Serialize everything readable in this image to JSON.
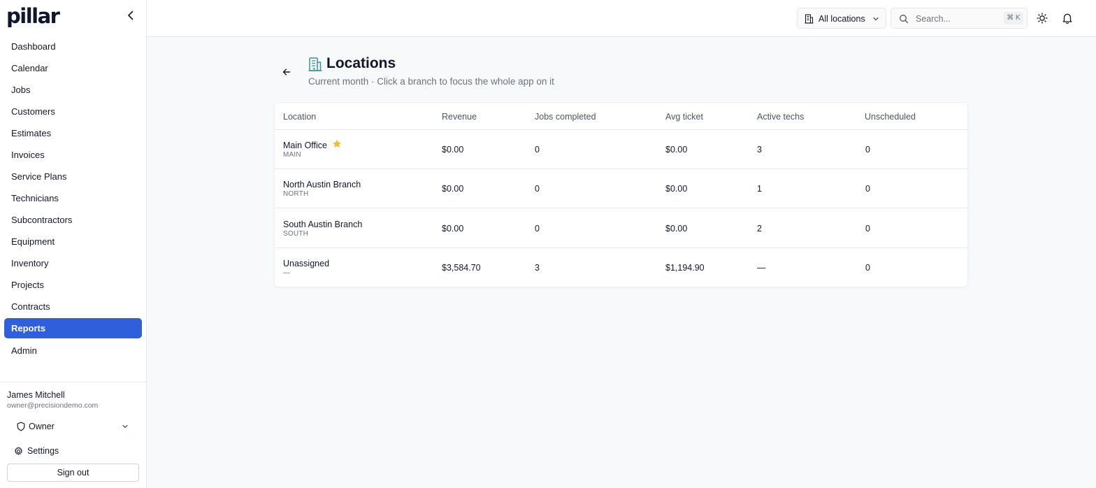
{
  "app": {
    "logo_text": "pillar"
  },
  "sidebar": {
    "items": [
      {
        "label": "Dashboard",
        "icon": ""
      },
      {
        "label": "Calendar"
      },
      {
        "label": "Jobs"
      },
      {
        "label": "Customers"
      },
      {
        "label": "Estimates"
      },
      {
        "label": "Invoices"
      },
      {
        "label": "Service Plans"
      },
      {
        "label": "Technicians"
      },
      {
        "label": "Subcontractors"
      },
      {
        "label": "Equipment"
      },
      {
        "label": "Inventory"
      },
      {
        "label": "Projects"
      },
      {
        "label": "Contracts"
      },
      {
        "label": "Reports",
        "active": true
      },
      {
        "label": "Admin"
      }
    ],
    "user": {
      "name": "James Mitchell",
      "email": "owner@precisiondemo.com",
      "role": "Owner"
    },
    "settings_label": "Settings",
    "signout_label": "Sign out"
  },
  "header": {
    "location_select": "All locations",
    "search_placeholder": "Search...",
    "shortcut": "⌘ K"
  },
  "page": {
    "title": "Locations",
    "subtitle": "Current month · Click a branch to focus the whole app on it"
  },
  "table": {
    "columns": [
      "Location",
      "Revenue",
      "Jobs completed",
      "Avg ticket",
      "Active techs",
      "Unscheduled"
    ],
    "rows": [
      {
        "name": "Main Office",
        "code": "MAIN",
        "starred": true,
        "revenue": "$0.00",
        "jobs_completed": "0",
        "avg_ticket": "$0.00",
        "active_techs": "3",
        "unscheduled": "0"
      },
      {
        "name": "North Austin Branch",
        "code": "NORTH",
        "revenue": "$0.00",
        "jobs_completed": "0",
        "avg_ticket": "$0.00",
        "active_techs": "1",
        "unscheduled": "0"
      },
      {
        "name": "South Austin Branch",
        "code": "SOUTH",
        "revenue": "$0.00",
        "jobs_completed": "0",
        "avg_ticket": "$0.00",
        "active_techs": "2",
        "unscheduled": "0"
      },
      {
        "name": "Unassigned",
        "code": "—",
        "revenue": "$3,584.70",
        "jobs_completed": "3",
        "avg_ticket": "$1,194.90",
        "active_techs": "—",
        "unscheduled": "0"
      }
    ]
  },
  "colors": {
    "accent": "#2f5fdb",
    "star": "#f5b82e",
    "title_icon": "#3b8fa8"
  }
}
